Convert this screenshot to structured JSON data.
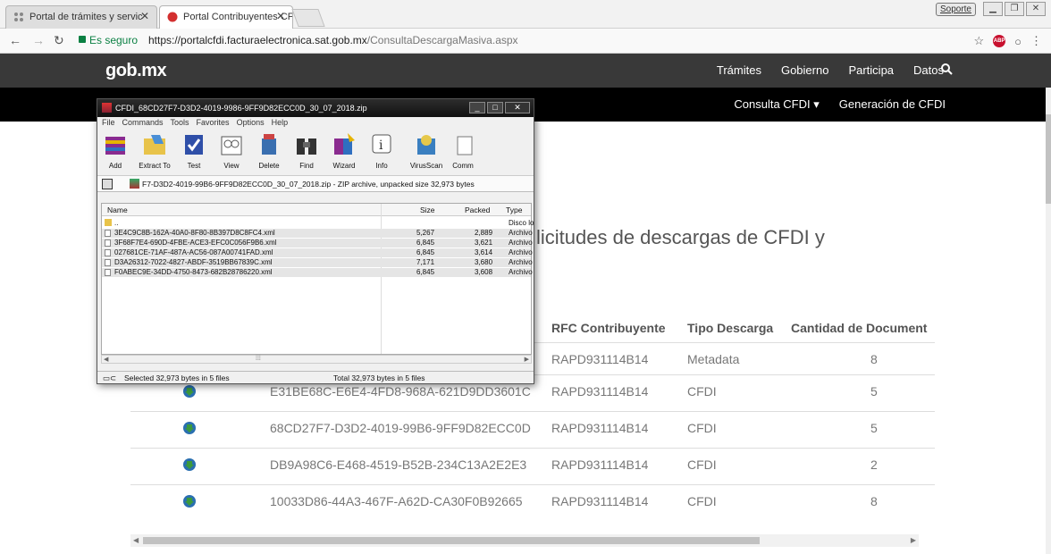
{
  "browser": {
    "tabs": [
      {
        "title": "Portal de trámites y servic",
        "active": false
      },
      {
        "title": "Portal Contribuyentes CF",
        "active": true
      }
    ],
    "support_label": "Soporte",
    "secure_label": "Es seguro",
    "url_host": "https://portalcfdi.facturaelectronica.sat.gob.mx",
    "url_path": "/ConsultaDescargaMasiva.aspx"
  },
  "gob": {
    "logo": "gob.mx",
    "nav": [
      "Trámites",
      "Gobierno",
      "Participa",
      "Datos"
    ],
    "subnav": [
      "Consulta CFDI ▾",
      "Generación de CFDI"
    ]
  },
  "page": {
    "title_fragment": "licitudes de descargas de CFDI y",
    "columns": [
      "RFC Contribuyente",
      "Tipo Descarga",
      "Cantidad de Document"
    ],
    "rows": [
      {
        "id": "",
        "rfc": "RAPD931114B14",
        "tipo": "Metadata",
        "cantidad": "8"
      },
      {
        "id": "E31BE68C-E6E4-4FD8-968A-621D9DD3601C",
        "rfc": "RAPD931114B14",
        "tipo": "CFDI",
        "cantidad": "5"
      },
      {
        "id": "68CD27F7-D3D2-4019-99B6-9FF9D82ECC0D",
        "rfc": "RAPD931114B14",
        "tipo": "CFDI",
        "cantidad": "5"
      },
      {
        "id": "DB9A98C6-E468-4519-B52B-234C13A2E2E3",
        "rfc": "RAPD931114B14",
        "tipo": "CFDI",
        "cantidad": "2"
      },
      {
        "id": "10033D86-44A3-467F-A62D-CA30F0B92665",
        "rfc": "RAPD931114B14",
        "tipo": "CFDI",
        "cantidad": "8"
      }
    ]
  },
  "archive": {
    "title": "CFDI_68CD27F7-D3D2-4019-9986-9FF9D82ECC0D_30_07_2018.zip",
    "menu": [
      "File",
      "Commands",
      "Tools",
      "Favorites",
      "Options",
      "Help"
    ],
    "tools": [
      "Add",
      "Extract To",
      "Test",
      "View",
      "Delete",
      "Find",
      "Wizard",
      "Info",
      "VirusScan",
      "Comm"
    ],
    "path": "F7-D3D2-4019-99B6-9FF9D82ECC0D_30_07_2018.zip - ZIP archive, unpacked size 32,973 bytes",
    "headers": [
      "Name",
      "Size",
      "Packed",
      "Type"
    ],
    "files": [
      {
        "name": "..",
        "size": "",
        "packed": "",
        "type": "Disco lo",
        "folder": true
      },
      {
        "name": "3E4C9C8B-162A-40A0-8F80-8B397D8C8FC4.xml",
        "size": "5,267",
        "packed": "2,889",
        "type": "Archivo"
      },
      {
        "name": "3F68F7E4-690D-4FBE-ACE3-EFC0C056F9B6.xml",
        "size": "6,845",
        "packed": "3,621",
        "type": "Archivo"
      },
      {
        "name": "027681CE-71AF-487A-AC56-087A00741FAD.xml",
        "size": "6,845",
        "packed": "3,614",
        "type": "Archivo"
      },
      {
        "name": "D3A26312-7022-4827-ABDF-3519BB67839C.xml",
        "size": "7,171",
        "packed": "3,680",
        "type": "Archivo"
      },
      {
        "name": "F0ABEC9E-34DD-4750-8473-682B28786220.xml",
        "size": "6,845",
        "packed": "3,608",
        "type": "Archivo"
      }
    ],
    "status_selected": "Selected 32,973 bytes in 5 files",
    "status_total": "Total 32,973 bytes in 5 files"
  },
  "colors": {
    "gob_bar": "#393939",
    "sub_bar": "#000000",
    "secure_green": "#0b8043",
    "download_blue": "#2a6fb0"
  }
}
